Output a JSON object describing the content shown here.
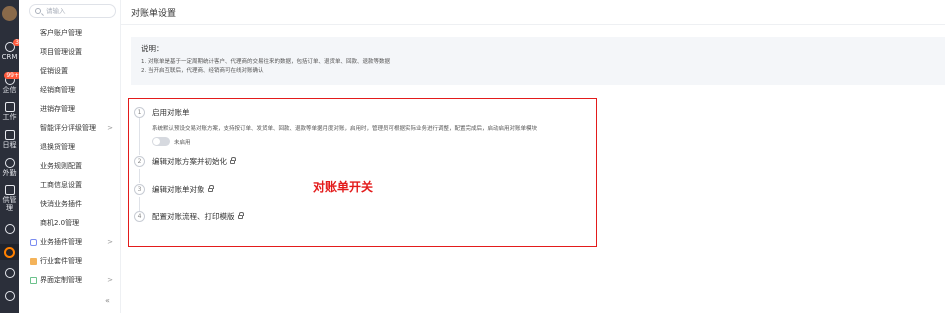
{
  "rail": {
    "items": [
      {
        "label": "CRM",
        "badge": "3"
      },
      {
        "label": "企信",
        "badge": "99+"
      },
      {
        "label": "工作",
        "badge": ""
      },
      {
        "label": "日程",
        "badge": ""
      },
      {
        "label": "外勤",
        "badge": ""
      },
      {
        "label": "供管理",
        "badge": ""
      }
    ]
  },
  "nav": {
    "search_placeholder": "请输入",
    "items": [
      {
        "label": "客户账户管理",
        "chevron": ""
      },
      {
        "label": "项目管理设置",
        "chevron": ""
      },
      {
        "label": "促销设置",
        "chevron": ""
      },
      {
        "label": "经销商管理",
        "chevron": ""
      },
      {
        "label": "进销存管理",
        "chevron": ""
      },
      {
        "label": "智能评分评级管理",
        "chevron": ">"
      },
      {
        "label": "退换货管理",
        "chevron": ""
      },
      {
        "label": "业务规则配置",
        "chevron": ""
      },
      {
        "label": "工商信息设置",
        "chevron": ""
      },
      {
        "label": "快消业务插件",
        "chevron": ""
      },
      {
        "label": "商机2.0管理",
        "chevron": ""
      }
    ],
    "groups": [
      {
        "label": "业务插件管理",
        "chevron": ">",
        "icon_color": "#7b8cf0"
      },
      {
        "label": "行业套件管理",
        "chevron": "",
        "icon_color": "#f4b35a"
      },
      {
        "label": "界面定制管理",
        "chevron": ">",
        "icon_color": "#6cc28c"
      }
    ],
    "collapse": "«"
  },
  "main": {
    "title": "对账单设置",
    "notice": {
      "title": "说明：",
      "lines": [
        "1. 对账单是基于一定周期统计客户、代理商的交易往来的数据，包括订单、退货单、回款、退款等数据",
        "2. 当开启互联后，代理商、经销商可在线对账确认"
      ]
    },
    "steps": [
      {
        "num": "1",
        "label": "启用对账单"
      },
      {
        "num": "2",
        "label": "编辑对账方案并初始化"
      },
      {
        "num": "3",
        "label": "编辑对账单对象"
      },
      {
        "num": "4",
        "label": "配置对账流程、打印模版"
      }
    ],
    "step1_desc": "系统默认预设交易对账方案，支持按订单、发货单、回款、退款等单据月度对账，启用时，管理员可根据实际业务进行调整，配置完成后，启动启用对账单模块",
    "toggle_text": "未启用",
    "annotation": "对账单开关"
  },
  "colors": {
    "highlight": "#e31b1b",
    "accent": "#ff8000",
    "rail_bg": "#2b2f3a"
  }
}
